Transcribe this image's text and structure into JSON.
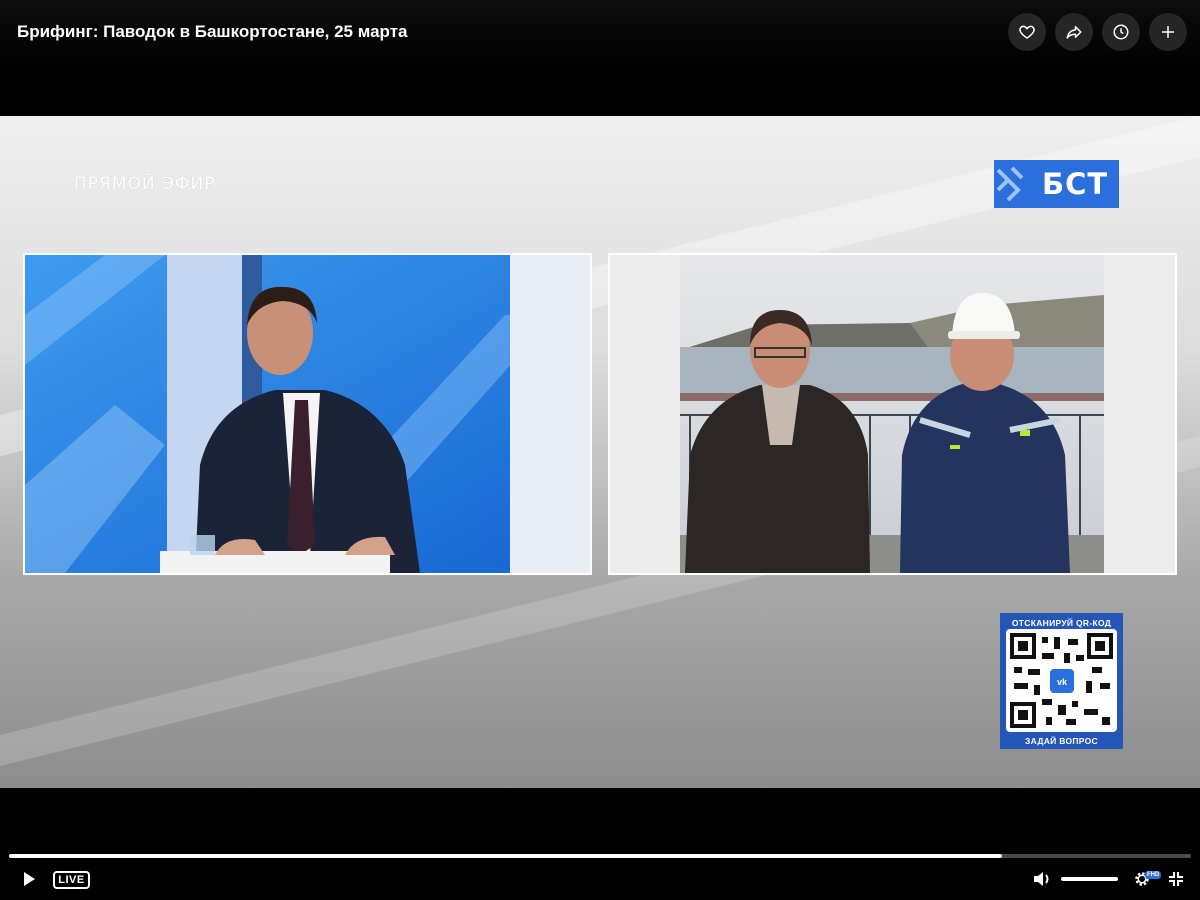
{
  "header": {
    "title": "Брифинг: Паводок в Башкортостане, 25 марта",
    "actions": [
      {
        "name": "like",
        "icon": "heart-icon"
      },
      {
        "name": "share",
        "icon": "share-icon"
      },
      {
        "name": "watch-later",
        "icon": "clock-icon"
      },
      {
        "name": "add",
        "icon": "plus-icon"
      }
    ]
  },
  "video": {
    "live_overlay": "ПРЯМОЙ ЭФИР",
    "channel_logo": "БСТ",
    "qr": {
      "top_text": "ОТСКАНИРУЙ QR-КОД",
      "bottom_text": "ЗАДАЙ ВОПРОС"
    },
    "colors": {
      "logo_blue": "#2b6fdc",
      "qr_blue": "#2456b8",
      "studio_blue": "#1e7de2"
    }
  },
  "player": {
    "live_label": "LIVE",
    "progress": 0.84,
    "volume": 1.0,
    "quality_badge": "FHD"
  }
}
